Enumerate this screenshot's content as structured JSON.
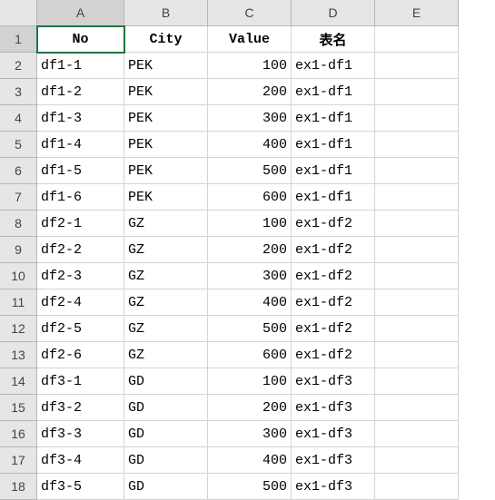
{
  "columns": [
    "A",
    "B",
    "C",
    "D",
    "E"
  ],
  "row_count": 18,
  "headers": [
    "No",
    "City",
    "Value",
    "表名"
  ],
  "active_cell": "A1",
  "chart_data": {
    "type": "table",
    "columns": [
      "No",
      "City",
      "Value",
      "表名"
    ],
    "rows": [
      {
        "No": "df1-1",
        "City": "PEK",
        "Value": 100,
        "表名": "ex1-df1"
      },
      {
        "No": "df1-2",
        "City": "PEK",
        "Value": 200,
        "表名": "ex1-df1"
      },
      {
        "No": "df1-3",
        "City": "PEK",
        "Value": 300,
        "表名": "ex1-df1"
      },
      {
        "No": "df1-4",
        "City": "PEK",
        "Value": 400,
        "表名": "ex1-df1"
      },
      {
        "No": "df1-5",
        "City": "PEK",
        "Value": 500,
        "表名": "ex1-df1"
      },
      {
        "No": "df1-6",
        "City": "PEK",
        "Value": 600,
        "表名": "ex1-df1"
      },
      {
        "No": "df2-1",
        "City": "GZ",
        "Value": 100,
        "表名": "ex1-df2"
      },
      {
        "No": "df2-2",
        "City": "GZ",
        "Value": 200,
        "表名": "ex1-df2"
      },
      {
        "No": "df2-3",
        "City": "GZ",
        "Value": 300,
        "表名": "ex1-df2"
      },
      {
        "No": "df2-4",
        "City": "GZ",
        "Value": 400,
        "表名": "ex1-df2"
      },
      {
        "No": "df2-5",
        "City": "GZ",
        "Value": 500,
        "表名": "ex1-df2"
      },
      {
        "No": "df2-6",
        "City": "GZ",
        "Value": 600,
        "表名": "ex1-df2"
      },
      {
        "No": "df3-1",
        "City": "GD",
        "Value": 100,
        "表名": "ex1-df3"
      },
      {
        "No": "df3-2",
        "City": "GD",
        "Value": 200,
        "表名": "ex1-df3"
      },
      {
        "No": "df3-3",
        "City": "GD",
        "Value": 300,
        "表名": "ex1-df3"
      },
      {
        "No": "df3-4",
        "City": "GD",
        "Value": 400,
        "表名": "ex1-df3"
      },
      {
        "No": "df3-5",
        "City": "GD",
        "Value": 500,
        "表名": "ex1-df3"
      }
    ]
  }
}
